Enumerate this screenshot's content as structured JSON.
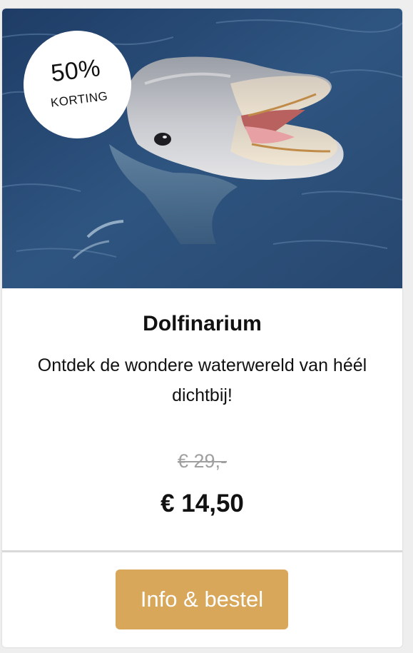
{
  "deal": {
    "badge": {
      "percent": "50%",
      "label": "KORTING"
    },
    "photo_subject": "dolphin",
    "title": "Dolfinarium",
    "description": "Ontdek de wondere waterwereld van héél dichtbij!",
    "old_price": "€ 29,-",
    "new_price": "€ 14,50",
    "cta_label": "Info & bestel"
  },
  "colors": {
    "button": "#d8a75a",
    "old_price": "#a0a0a0",
    "water": "#2c4f78",
    "page_background": "#eeeeee"
  }
}
